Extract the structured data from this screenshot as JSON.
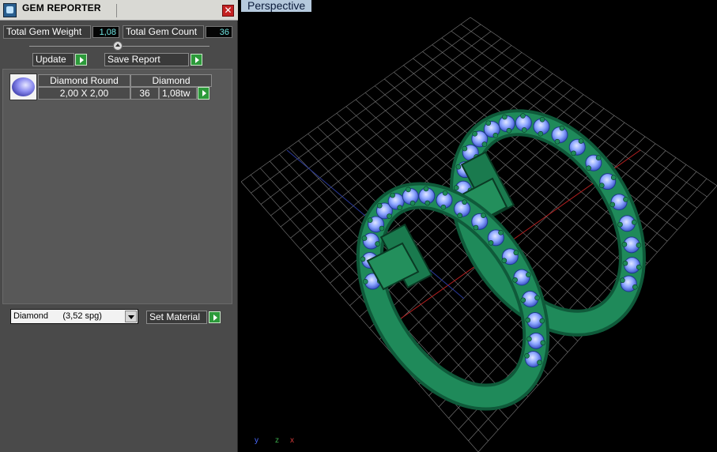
{
  "window": {
    "title": "GEM REPORTER",
    "close_glyph": "✕"
  },
  "stats": {
    "weight_label": "Total Gem Weight",
    "weight_value": "1,08",
    "count_label": "Total Gem Count",
    "count_value": "36"
  },
  "actions": {
    "update_label": "Update",
    "save_label": "Save Report"
  },
  "gem_table": {
    "header": [
      "Diamond Round",
      "Diamond"
    ],
    "row": {
      "size": "2,00 X 2,00",
      "count": "36",
      "weight": "1,08tw"
    }
  },
  "material": {
    "selected": "Diamond      (3,52 spg)",
    "set_label": "Set Material"
  },
  "viewport": {
    "label": "Perspective"
  },
  "axes": {
    "y": "y",
    "z": "z",
    "x": "x"
  },
  "colors": {
    "metal": "#1f8a5a",
    "gem": "#8fa8ff",
    "grid": "#7a7a7a",
    "axis_x": "#b52020",
    "axis_y": "#2a3a9a",
    "accent_green": "#2c9a3a",
    "value_cyan": "#6fe3e0"
  },
  "icons": [
    "app-icon",
    "close-icon",
    "collapse-icon",
    "go-arrow-icon",
    "gem-thumbnail",
    "dropdown-arrow-icon"
  ]
}
